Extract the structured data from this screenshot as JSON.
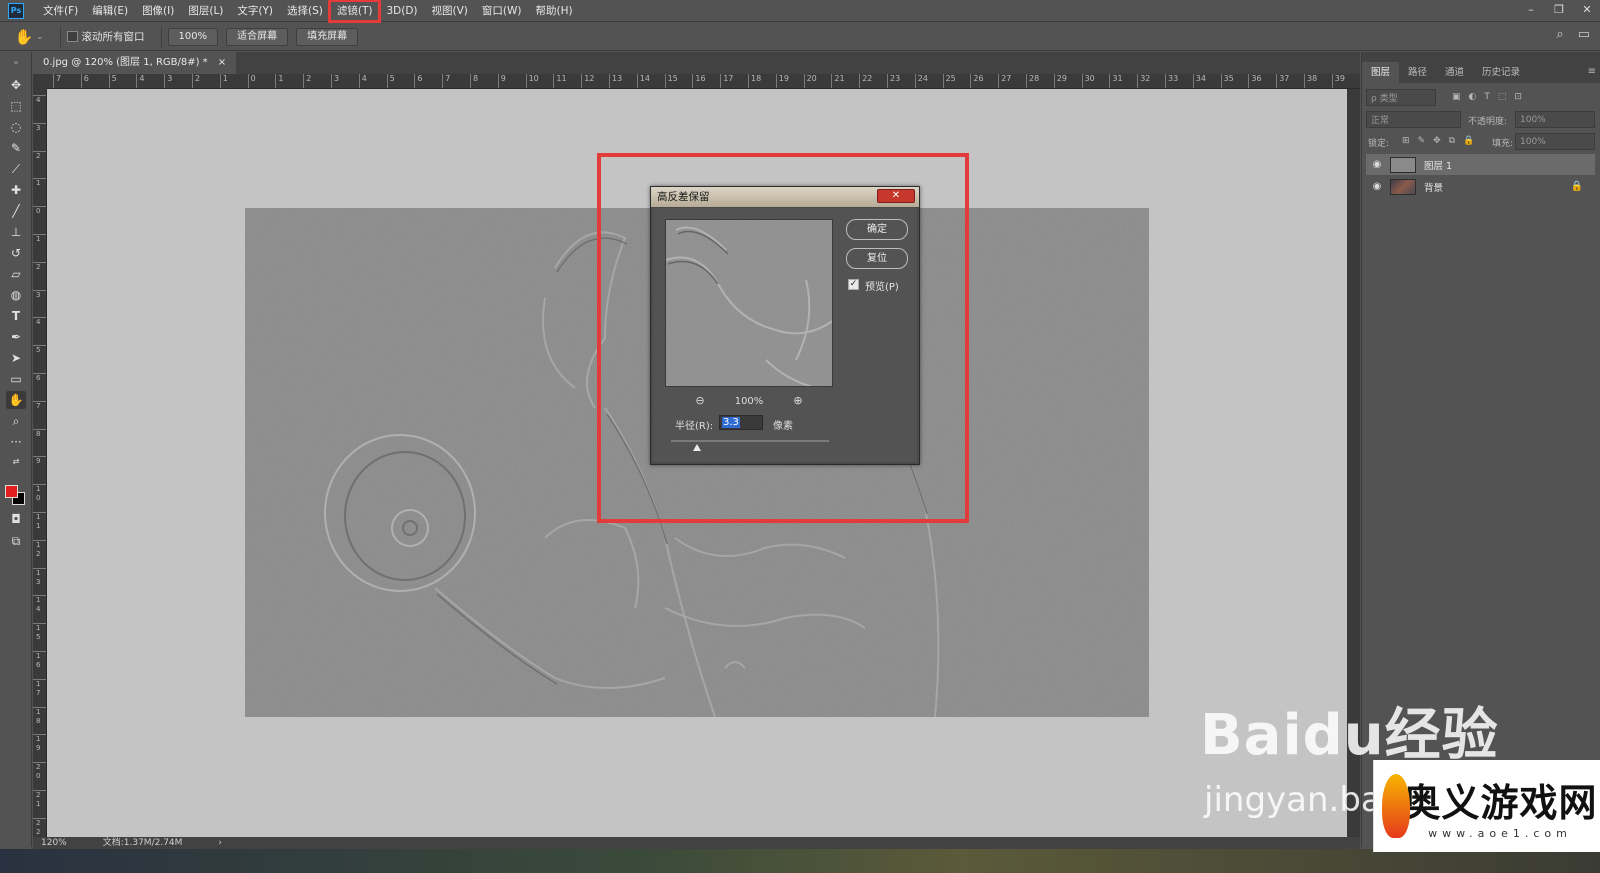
{
  "app": {
    "logo": "Ps",
    "menu": [
      "文件(F)",
      "编辑(E)",
      "图像(I)",
      "图层(L)",
      "文字(Y)",
      "选择(S)",
      "滤镜(T)",
      "3D(D)",
      "视图(V)",
      "窗口(W)",
      "帮助(H)"
    ],
    "highlighted_menu_index": 6,
    "window_controls": [
      "minimize-icon",
      "restore-icon",
      "close-icon"
    ]
  },
  "options": {
    "tool_icon": "hand-icon",
    "scroll_all_label": "滚动所有窗口",
    "zoom_btn": "100%",
    "fit_btn": "适合屏幕",
    "fill_btn": "填充屏幕"
  },
  "document": {
    "tab_title": "0.jpg @ 120% (图层 1, RGB/8#) *",
    "tab_close": "×",
    "ruler_top": [
      "7",
      "6",
      "5",
      "4",
      "3",
      "2",
      "1",
      "0",
      "1",
      "2",
      "3",
      "4",
      "5",
      "6",
      "7",
      "8",
      "9",
      "10",
      "11",
      "12",
      "13",
      "14",
      "15",
      "16",
      "17",
      "18",
      "19",
      "20",
      "21",
      "22",
      "23",
      "24",
      "25",
      "26",
      "27",
      "28",
      "29",
      "30",
      "31",
      "32",
      "33",
      "34",
      "35",
      "36",
      "37",
      "38",
      "39"
    ],
    "ruler_left": [
      "4",
      "3",
      "2",
      "1",
      "0",
      "1",
      "2",
      "3",
      "4",
      "5",
      "6",
      "7",
      "8",
      "9",
      "1 0",
      "1 1",
      "1 2",
      "1 3",
      "1 4",
      "1 5",
      "1 6",
      "1 7",
      "1 8",
      "1 9",
      "2 0",
      "2 1",
      "2 2"
    ]
  },
  "dialog": {
    "title": "高反差保留",
    "close": "✕",
    "ok_label": "确定",
    "reset_label": "复位",
    "preview_label": "预览(P)",
    "preview_checked": true,
    "zoom_value": "100%",
    "radius_label": "半径(R):",
    "radius_value": "3.3",
    "radius_unit": "像素"
  },
  "layers_panel": {
    "tabs": [
      "图层",
      "路径",
      "通道",
      "历史记录"
    ],
    "active_tab_index": 0,
    "filter_placeholder": "ρ 类型",
    "blend_mode": "正常",
    "opacity_label": "不透明度:",
    "opacity_value": "100%",
    "lock_label": "锁定:",
    "fill_label": "填充:",
    "fill_value": "100%",
    "layers": [
      {
        "name": "图层 1",
        "selected": true,
        "locked": false
      },
      {
        "name": "背景",
        "selected": false,
        "locked": true
      }
    ]
  },
  "status": {
    "zoom": "120%",
    "doc_info": "文档:1.37M/2.74M",
    "arrow": "›"
  },
  "watermarks": {
    "baidu": "Baidu经验",
    "baidu_sub": "jingyan.baidu",
    "aoe_title": "奥义游戏网",
    "aoe_url": "www.aoe1.com"
  },
  "colors": {
    "highlight_red": "#e33a3a",
    "foreground": "#e31e1e",
    "background": "#000000",
    "canvas_bg": "#c4c4c4",
    "image_gray": "#8c8c8c"
  }
}
